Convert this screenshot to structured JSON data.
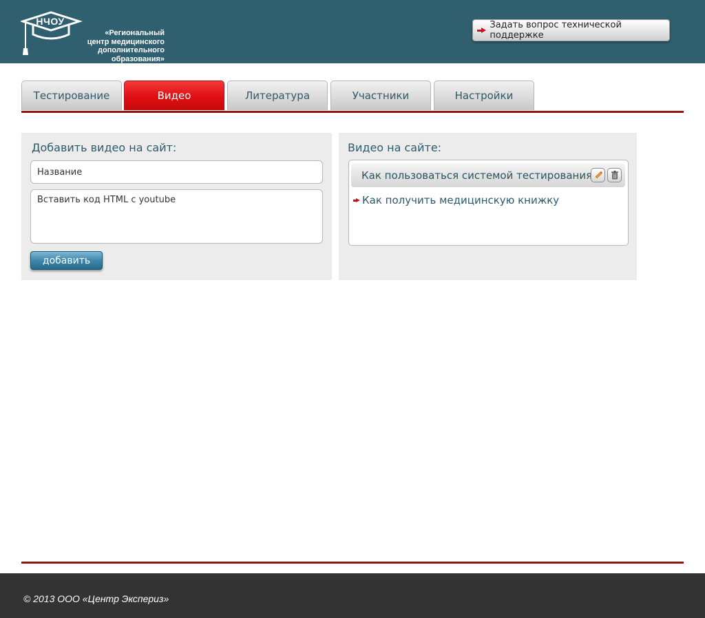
{
  "header": {
    "logo_abbr": "НЧОУ",
    "logo_name_line1": "«Региональный",
    "logo_name_line2": "центр медицинского",
    "logo_name_line3": "дополнительного образования»",
    "support_button": "Задать вопрос технической поддержке"
  },
  "tabs": [
    {
      "label": "Тестирование",
      "active": false
    },
    {
      "label": "Видео",
      "active": true
    },
    {
      "label": "Литература",
      "active": false
    },
    {
      "label": "Участники",
      "active": false
    },
    {
      "label": "Настройки",
      "active": false
    }
  ],
  "add_video": {
    "title": "Добавить видео на сайт:",
    "name_placeholder": "Название",
    "code_placeholder": "Вставить код HTML с youtube",
    "add_button": "добавить"
  },
  "site_videos": {
    "title": "Видео на сайте:",
    "items": [
      {
        "title": "Как пользоваться системой тестирования",
        "selected": true
      },
      {
        "title": "Как получить медицинскую книжку",
        "selected": false
      }
    ]
  },
  "footer": {
    "copyright": "© 2013 ООО «Центр Экспериз»"
  },
  "colors": {
    "header_bg": "#30606f",
    "accent_red": "#e00e12",
    "divider": "#8e1512",
    "footer_bg": "#333333"
  }
}
